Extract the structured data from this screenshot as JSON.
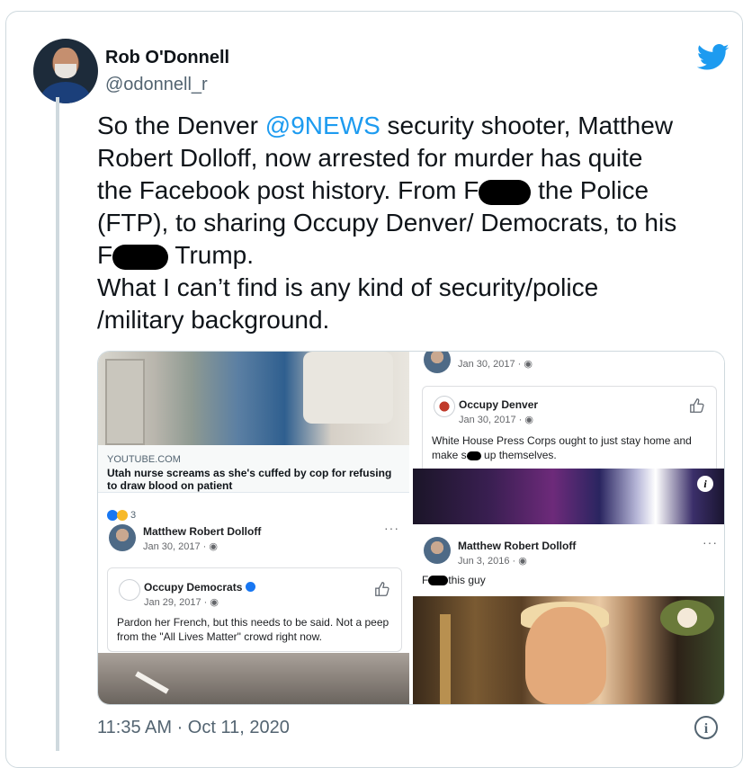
{
  "tweet": {
    "author_name": "Rob O'Donnell",
    "author_handle": "@odonnell_r",
    "text_before_mention": "So the Denver ",
    "mention": "@9NEWS",
    "text_line_a": " security shooter, Matthew\nRobert Dolloff, now arrested for murder has quite\nthe Facebook post history. From F",
    "text_line_b": " the Police\n(FTP), to sharing Occupy Denver/ Democrats, to his\nF",
    "text_line_c": " Trump.\nWhat I can’t find is any kind of security/police\n/military background.",
    "timestamp": "11:35 AM · Oct 11, 2020",
    "info_icon": "info-icon",
    "brand_icon": "twitter-bird-icon"
  },
  "media": {
    "left": {
      "link_source": "YOUTUBE.COM",
      "link_title": "Utah nurse screams as she's cuffed by cop for refusing to draw blood on patient",
      "reaction_count": "3",
      "post_author": "Matthew Robert Dolloff",
      "post_date": "Jan 30, 2017 ·",
      "shared_page": "Occupy Democrats",
      "shared_date": "Jan 29, 2017 ·",
      "shared_text": "Pardon her French, but this needs to be said. Not a peep from the \"All Lives Matter\" crowd right now."
    },
    "right": {
      "top_date": "Jan 30, 2017 ·",
      "shared_page": "Occupy Denver",
      "shared_date": "Jan 30, 2017 ·",
      "shared_text_a": "White House Press Corps ought to just stay home and make s",
      "shared_text_b": " up themselves.",
      "post_author": "Matthew Robert Dolloff",
      "post_date": "Jun 3, 2016 ·",
      "post_text_a": "F",
      "post_text_b": "this guy",
      "info_label": "i"
    }
  },
  "colors": {
    "accent": "#1d9bf0",
    "text": "#0f1419",
    "muted": "#536471",
    "facebook_blue": "#1877f2"
  }
}
